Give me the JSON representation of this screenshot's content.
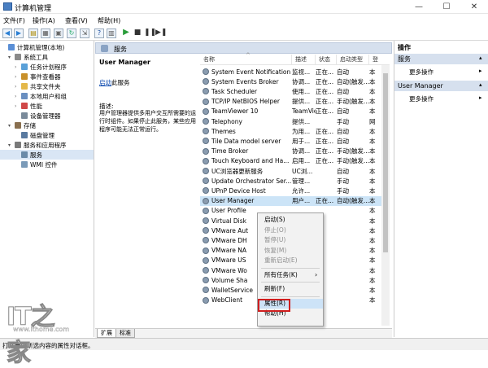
{
  "window": {
    "title": "计算机管理",
    "min": "—",
    "max": "☐",
    "close": "✕"
  },
  "menu": [
    "文件(F)",
    "操作(A)",
    "查看(V)",
    "帮助(H)"
  ],
  "tree": [
    {
      "label": "计算机管理(本地)",
      "indent": 0,
      "arrow": "",
      "icon": "computer-icon"
    },
    {
      "label": "系统工具",
      "indent": 1,
      "arrow": "▾",
      "icon": "tools-icon"
    },
    {
      "label": "任务计划程序",
      "indent": 2,
      "arrow": "›",
      "icon": "clock-icon"
    },
    {
      "label": "事件查看器",
      "indent": 2,
      "arrow": "›",
      "icon": "event-icon"
    },
    {
      "label": "共享文件夹",
      "indent": 2,
      "arrow": "›",
      "icon": "folder-icon"
    },
    {
      "label": "本地用户和组",
      "indent": 2,
      "arrow": "›",
      "icon": "users-icon"
    },
    {
      "label": "性能",
      "indent": 2,
      "arrow": "›",
      "icon": "performance-icon"
    },
    {
      "label": "设备管理器",
      "indent": 2,
      "arrow": "",
      "icon": "device-icon"
    },
    {
      "label": "存储",
      "indent": 1,
      "arrow": "▾",
      "icon": "storage-icon"
    },
    {
      "label": "磁盘管理",
      "indent": 2,
      "arrow": "",
      "icon": "disk-icon"
    },
    {
      "label": "服务和应用程序",
      "indent": 1,
      "arrow": "▾",
      "icon": "apps-icon"
    },
    {
      "label": "服务",
      "indent": 2,
      "arrow": "",
      "icon": "gear-icon"
    },
    {
      "label": "WMI 控件",
      "indent": 2,
      "arrow": "",
      "icon": "wmi-icon"
    }
  ],
  "services_header": "服务",
  "desc": {
    "title": "User Manager",
    "link": "启动",
    "link_suffix": "此服务",
    "label": "描述:",
    "text": "用户管理器提供多用户交互所需要的运行时组件。如果停止此服务，某些应用程序可能无法正常运行。"
  },
  "columns": [
    "名称",
    "描述",
    "状态",
    "启动类型",
    "登"
  ],
  "rows": [
    [
      "System Event Notification ...",
      "监视...",
      "正在...",
      "自动",
      "本"
    ],
    [
      "System Events Broker",
      "协调...",
      "正在...",
      "自动(触发...",
      "本"
    ],
    [
      "Task Scheduler",
      "使用...",
      "正在...",
      "自动",
      "本"
    ],
    [
      "TCP/IP NetBIOS Helper",
      "提供...",
      "正在...",
      "手动(触发...",
      "本"
    ],
    [
      "TeamViewer 10",
      "TeamViewer ...",
      "正在...",
      "自动",
      "本"
    ],
    [
      "Telephony",
      "提供...",
      "",
      "手动",
      "网"
    ],
    [
      "Themes",
      "为用...",
      "正在...",
      "自动",
      "本"
    ],
    [
      "Tile Data model server",
      "用于...",
      "正在...",
      "自动",
      "本"
    ],
    [
      "Time Broker",
      "协调...",
      "正在...",
      "手动(触发...",
      "本"
    ],
    [
      "Touch Keyboard and Ha...",
      "启用...",
      "正在...",
      "手动(触发...",
      "本"
    ],
    [
      "UC浏览器更新服务",
      "UC浏...",
      "",
      "自动",
      "本"
    ],
    [
      "Update Orchestrator Ser...",
      "管理...",
      "",
      "手动",
      "本"
    ],
    [
      "UPnP Device Host",
      "允许...",
      "",
      "手动",
      "本"
    ],
    [
      "User Manager",
      "用户...",
      "正在...",
      "自动(触发...",
      "本"
    ],
    [
      "User Profile",
      "",
      "",
      "",
      "本"
    ],
    [
      "Virtual Disk",
      "",
      "",
      "",
      "本"
    ],
    [
      "VMware Aut",
      "",
      "",
      "",
      "本"
    ],
    [
      "VMware DH",
      "",
      "",
      "",
      "本"
    ],
    [
      "VMware NA",
      "",
      "",
      "",
      "本"
    ],
    [
      "VMware US",
      "",
      "",
      "",
      "本"
    ],
    [
      "VMware Wo",
      "",
      "",
      "",
      "本"
    ],
    [
      "Volume Sha",
      "",
      "",
      "",
      "本"
    ],
    [
      "WalletService",
      "",
      "",
      "",
      "本"
    ],
    [
      "WebClient",
      "",
      "",
      "",
      "本"
    ]
  ],
  "actions": {
    "header": "操作",
    "g1": "服务",
    "g1_more": "更多操作",
    "g2": "User Manager",
    "g2_more": "更多操作"
  },
  "context_menu": [
    {
      "label": "启动(S)",
      "state": "normal"
    },
    {
      "label": "停止(O)",
      "state": "disabled"
    },
    {
      "label": "暂停(U)",
      "state": "disabled"
    },
    {
      "label": "恢复(M)",
      "state": "disabled"
    },
    {
      "label": "重新启动(E)",
      "state": "disabled"
    },
    {
      "label": "所有任务(K)",
      "state": "normal",
      "submenu": "›"
    },
    {
      "label": "刷新(F)",
      "state": "normal"
    },
    {
      "label": "属性(R)",
      "state": "highlight"
    },
    {
      "label": "帮助(H)",
      "state": "normal"
    }
  ],
  "tabs": [
    "扩展",
    "标准"
  ],
  "status": "打开当前所选内容的属性对话框。",
  "watermark": {
    "logo": "IT之家",
    "url": "www.ithome.com"
  }
}
